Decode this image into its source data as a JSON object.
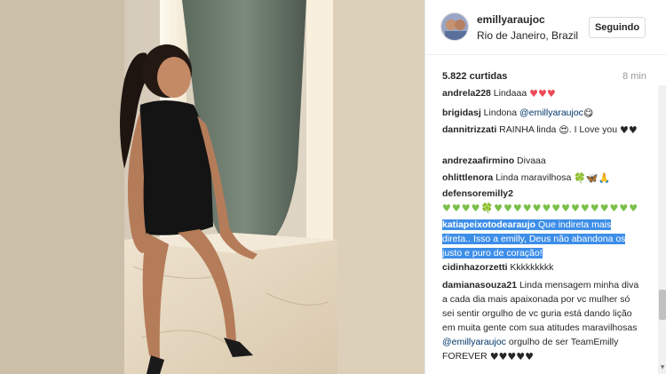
{
  "post": {
    "username": "emillyaraujoc",
    "location": "Rio de Janeiro, Brazil",
    "follow_label": "Seguindo",
    "likes": "5.822 curtidas",
    "time": "8 min"
  },
  "comments": [
    {
      "user": "andrela228",
      "text": " Lindaaa",
      "emoji": "♥♥♥"
    },
    {
      "user": "brigidasj",
      "text": " Lindona ",
      "mention": "@emillyaraujoc",
      "emoji": " 😋"
    },
    {
      "user": "dannitrizzati",
      "text": " RAINHA linda ",
      "emoji": "😍",
      "text2": ". I Love you ",
      "emoji2": "♥♥"
    },
    {
      "user": "andrezaafirmino",
      "text": " Divaaa"
    },
    {
      "user": "ohlittlenora",
      "text": " Linda maravilhosa ",
      "emoji": "🍀🦋🙏"
    },
    {
      "user": "defensoremilly2",
      "text": " ",
      "emoji": "♥♥♥♥🍀♥♥♥♥♥♥♥♥♥♥♥♥♥♥♥"
    },
    {
      "user": "katiapeixotodearaujo",
      "text": " Que indireta mais direta.. Isso a emilly, Deus não abandona os justo e puro de coração!",
      "selected": true
    },
    {
      "user": "cidinhazorzetti",
      "text": " Kkkkkkkkk"
    },
    {
      "user": "damianasouza21",
      "text": " Linda mensagem minha diva a cada dia mais apaixonada por vc mulher só sei sentir orgulho de vc guria está dando lição em muita gente com sua atitudes maravilhosas ",
      "mention": "@emillyaraujoc",
      "text2": " orgulho de ser TeamEmilly FOREVER ",
      "emoji2": "♥♥♥♥♥"
    }
  ],
  "colors": {
    "selection": "#3d8ee8",
    "mention": "#003569",
    "heart": "#ed4956"
  },
  "icons": {
    "scroll_down": "triangle-down"
  }
}
